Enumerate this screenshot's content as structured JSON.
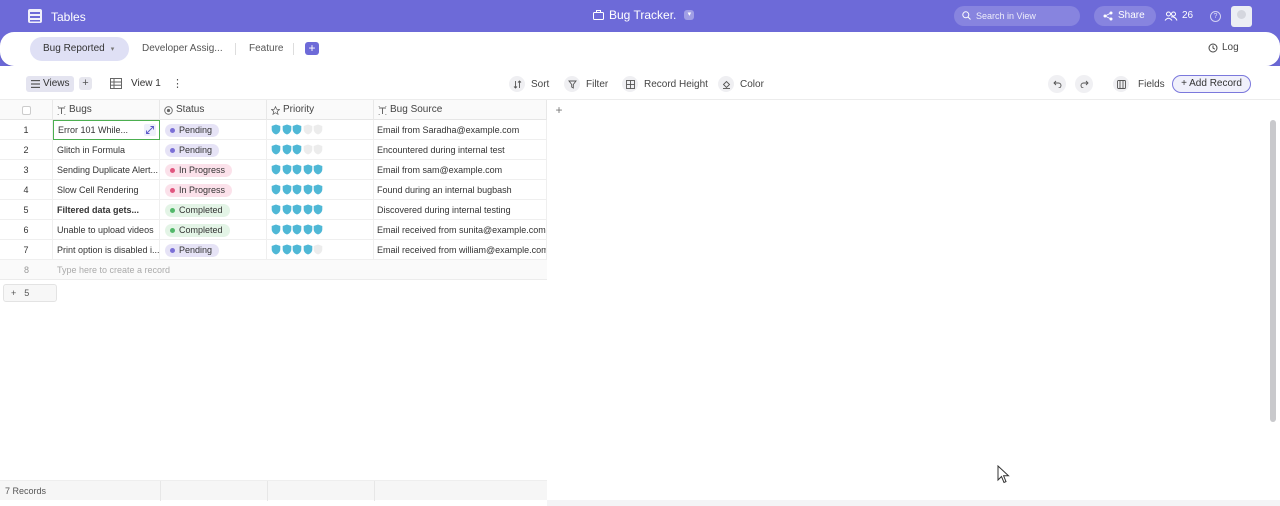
{
  "header": {
    "app_name": "Tables",
    "doc_title": "Bug Tracker.",
    "doc_caret": "▾",
    "search_placeholder": "Search in View",
    "share_label": "Share",
    "collaborators": "26",
    "help": "?"
  },
  "tabs": {
    "items": [
      "Bug Reported",
      "Developer Assig...",
      "Feature"
    ],
    "active_caret": "▾",
    "add": "+",
    "log_label": "Log"
  },
  "toolbar": {
    "views_label": "Views",
    "add_view": "+",
    "view_name": "View 1",
    "kebab": "⋮",
    "sort_label": "Sort",
    "filter_label": "Filter",
    "record_height_label": "Record Height",
    "color_label": "Color",
    "fields_label": "Fields",
    "add_record_label": "+ Add Record"
  },
  "grid": {
    "columns": [
      "Bugs",
      "Status",
      "Priority",
      "Bug Source"
    ],
    "add_column": "+",
    "rows": [
      {
        "num": "1",
        "bug": "Error 101 While...",
        "status": "Pending",
        "priority": 3,
        "source": "Email from Saradha@example.com"
      },
      {
        "num": "2",
        "bug": "Glitch in Formula",
        "status": "Pending",
        "priority": 3,
        "source": "Encountered during internal test"
      },
      {
        "num": "3",
        "bug": "Sending Duplicate Alert...",
        "status": "In Progress",
        "priority": 5,
        "source": "Email from sam@example.com"
      },
      {
        "num": "4",
        "bug": "Slow Cell Rendering",
        "status": "In Progress",
        "priority": 5,
        "source": "Found during an internal bugbash"
      },
      {
        "num": "5",
        "bug": "Filtered data gets...",
        "status": "Completed",
        "priority": 5,
        "source": "Discovered during internal testing"
      },
      {
        "num": "6",
        "bug": "Unable to upload videos",
        "status": "Completed",
        "priority": 5,
        "source": "Email received from sunita@example.com"
      },
      {
        "num": "7",
        "bug": "Print option is disabled i...",
        "status": "Pending",
        "priority": 4,
        "source": "Email received from william@example.com"
      }
    ],
    "new_row_num": "8",
    "new_row_placeholder": "Type here to create a record",
    "priority_max": 5
  },
  "group_button": {
    "plus": "+",
    "count": "5"
  },
  "footer": {
    "records": "7 Records"
  },
  "colors": {
    "brand": "#6d6ad8",
    "pending_bg": "#e6e3f6",
    "pending_dot": "#7b6fd6",
    "progress_bg": "#fbe1ea",
    "progress_dot": "#e0567f",
    "completed_bg": "#e3f4e6",
    "completed_dot": "#52b86a",
    "shield_on": "#4fb8d6",
    "shield_off": "#ececec"
  }
}
